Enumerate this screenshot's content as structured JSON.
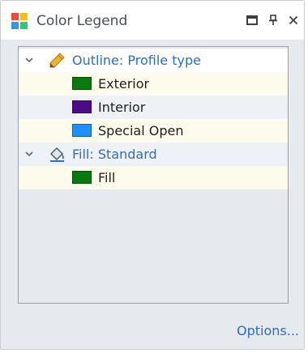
{
  "window": {
    "title": "Color Legend",
    "app_icon": "color-legend-icon",
    "buttons": [
      {
        "name": "restore-button",
        "icon": "restore-icon"
      },
      {
        "name": "pin-button",
        "icon": "pin-icon"
      },
      {
        "name": "close-button",
        "icon": "close-icon"
      }
    ]
  },
  "legend": {
    "groups": [
      {
        "label": "Outline: Profile type",
        "icon": "pencil-icon",
        "expanded": true,
        "items": [
          {
            "label": "Exterior",
            "color": "#0a7a10"
          },
          {
            "label": "Interior",
            "color": "#4b0a86"
          },
          {
            "label": "Special Open",
            "color": "#1e90ff"
          }
        ]
      },
      {
        "label": "Fill: Standard",
        "icon": "paint-bucket-icon",
        "expanded": true,
        "items": [
          {
            "label": "Fill",
            "color": "#0a7a10"
          }
        ]
      }
    ]
  },
  "footer": {
    "options_label": "Options..."
  },
  "colors": {
    "link": "#2a6fc9",
    "panel_bg": "#e6e9ed"
  }
}
